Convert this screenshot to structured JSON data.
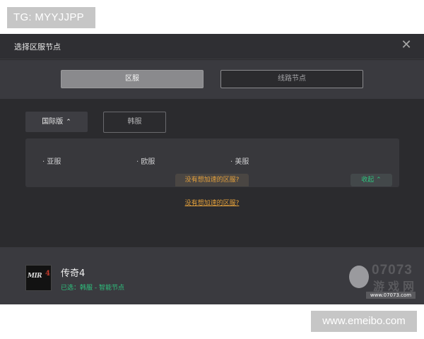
{
  "overlay": {
    "tg_label": "TG: MYYJJPP",
    "site_label": "www.emeibo.com"
  },
  "dialog": {
    "title": "选择区服节点",
    "close_glyph": "✕"
  },
  "tabs": [
    {
      "label": "区服",
      "active": true
    },
    {
      "label": "线路节点",
      "active": false
    }
  ],
  "version_toggle": {
    "label": "国际版",
    "chevron": "⌃"
  },
  "korea_button": {
    "label": "韩服"
  },
  "regions": [
    "· 亚服",
    "· 欧服",
    "· 美服"
  ],
  "tip_chip": {
    "label": "没有想加速的区服?"
  },
  "collapse_button": {
    "label": "收起 ⌃"
  },
  "link_tip": {
    "label": "没有想加速的区服?"
  },
  "footer": {
    "icon_text": "MIR",
    "icon_num": "4",
    "game_name": "传奇4",
    "selection": "已选：韩服 - 智能节点"
  },
  "watermark": {
    "num": "07073",
    "cn": "游戏网",
    "url": "www.07073.com"
  },
  "colors": {
    "accent_orange": "#e6a23c",
    "accent_green": "#2ec27e",
    "dialog_bg": "#2b2b2e"
  }
}
